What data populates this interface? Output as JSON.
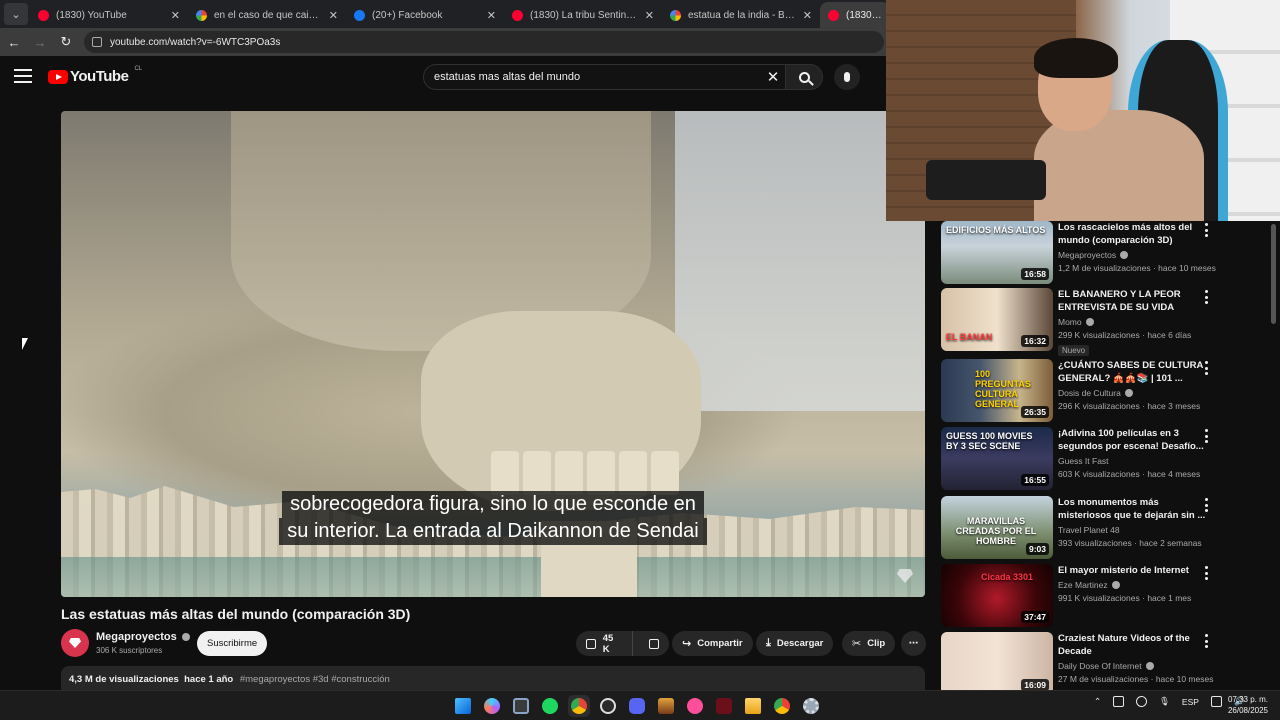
{
  "browser": {
    "tabs": [
      {
        "label": "(1830) YouTube",
        "icon": "youtube-favicon",
        "active": false
      },
      {
        "label": "en el caso de que caiga en una",
        "icon": "google-favicon",
        "active": false
      },
      {
        "label": "(20+) Facebook",
        "icon": "facebook-favicon",
        "active": false
      },
      {
        "label": "(1830) La tribu Sentinelesa en la",
        "icon": "youtube-favicon",
        "active": false
      },
      {
        "label": "estatua de la india - Buscar con",
        "icon": "google-favicon",
        "active": false
      },
      {
        "label": "(1830) Las es",
        "icon": "youtube-favicon",
        "active": true
      }
    ],
    "url": "youtube.com/watch?v=-6WTC3POa3s"
  },
  "header": {
    "logo_text": "YouTube",
    "country_code": "CL",
    "search_value": "estatuas mas altas del mundo"
  },
  "player": {
    "captions": [
      "sobrecogedora figura, sino lo que esconde en",
      "su interior. La entrada al Daikannon de Sendai"
    ]
  },
  "video": {
    "title": "Las estatuas más altas del mundo (comparación 3D)",
    "channel": "Megaproyectos",
    "subscribers": "306 K suscriptores",
    "subscribe_label": "Suscribirme",
    "likes": "45 K",
    "share_label": "Compartir",
    "download_label": "Descargar",
    "clip_label": "Clip",
    "views": "4,3 M de visualizaciones",
    "age": "hace 1 año",
    "tags": "#megaproyectos #3d #construcción"
  },
  "recommendations": [
    {
      "thumb_text": "EDIFICIOS MÁS ALTOS",
      "title": "Los rascacielos más altos del mundo (comparación 3D)",
      "channel": "Megaproyectos",
      "verified": true,
      "views": "1,2 M de visualizaciones",
      "age": "hace 10 meses",
      "duration": "16:58",
      "badge": ""
    },
    {
      "thumb_text": "EL BANAN",
      "title": "EL BANANERO Y LA PEOR ENTREVISTA DE SU VIDA",
      "channel": "Momo",
      "verified": true,
      "views": "299 K visualizaciones",
      "age": "hace 6 días",
      "duration": "16:32",
      "badge": "Nuevo"
    },
    {
      "thumb_text": "100 PREGUNTAS CULTURA GENERAL",
      "title": "¿CUÁNTO SABES DE CULTURA GENERAL? 🎪🎪📚 | 101 ...",
      "channel": "Dosis de Cultura",
      "verified": true,
      "views": "296 K visualizaciones",
      "age": "hace 3 meses",
      "duration": "26:35",
      "badge": ""
    },
    {
      "thumb_text": "GUESS 100 MOVIES BY 3 SEC SCENE",
      "title": "¡Adivina 100 películas en 3 segundos por escena! Desafío...",
      "channel": "Guess It Fast",
      "verified": false,
      "views": "603 K visualizaciones",
      "age": "hace 4 meses",
      "duration": "16:55",
      "badge": ""
    },
    {
      "thumb_text": "MARAVILLAS CREADAS POR EL HOMBRE",
      "title": "Los monumentos más misteriosos que te dejarán sin ...",
      "channel": "Travel Planet 48",
      "verified": false,
      "views": "393 visualizaciones",
      "age": "hace 2 semanas",
      "duration": "9:03",
      "badge": ""
    },
    {
      "thumb_text": "Cicada 3301",
      "title": "El mayor misterio de Internet",
      "channel": "Eze Martinez",
      "verified": true,
      "views": "991 K visualizaciones",
      "age": "hace 1 mes",
      "duration": "37:47",
      "badge": ""
    },
    {
      "thumb_text": "",
      "title": "Craziest Nature Videos of the Decade",
      "channel": "Daily Dose Of Internet",
      "verified": true,
      "views": "27 M de visualizaciones",
      "age": "hace 10 meses",
      "duration": "16:09",
      "badge": ""
    }
  ],
  "taskbar": {
    "language": "ESP",
    "time": "07:33 p. m.",
    "date": "26/08/2025"
  },
  "colors": {
    "background": "#0f0f0f",
    "accent_red": "#ff0000",
    "subscribe_bg": "#f1f1f1",
    "pill_bg": "#272727"
  }
}
